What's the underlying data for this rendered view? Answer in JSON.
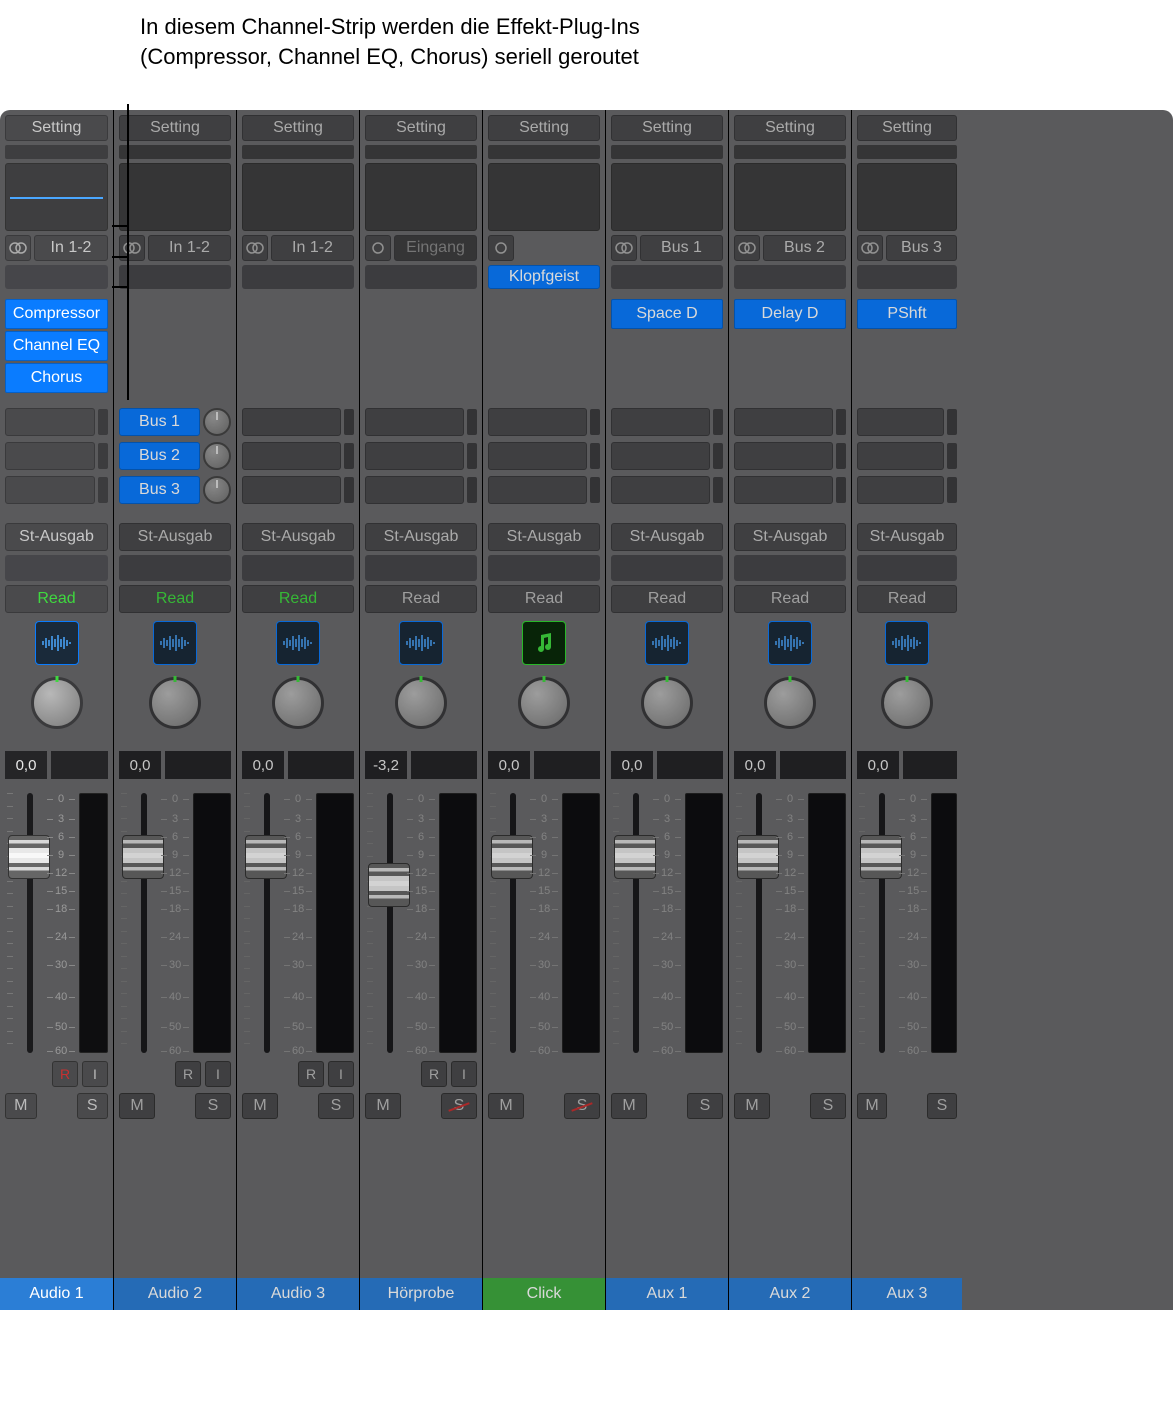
{
  "callout": "In diesem Channel-Strip werden die Effekt-Plug-Ins (Compressor, Channel EQ, Chorus) seriell geroutet",
  "labels": {
    "setting": "Setting",
    "output": "St-Ausgab",
    "read": "Read",
    "mute": "M",
    "solo": "S",
    "rec": "R",
    "input_mon": "I"
  },
  "scale": [
    "0",
    "3",
    "6",
    "9",
    "12",
    "15",
    "18",
    "24",
    "30",
    "40",
    "50",
    "60"
  ],
  "strips": [
    {
      "name": "Audio 1",
      "nameColor": "blue",
      "input": "In 1-2",
      "stereo": true,
      "inst": "",
      "plugins": [
        "Compressor",
        "Channel EQ",
        "Chorus"
      ],
      "sends": [],
      "autoGreen": true,
      "iconMusic": false,
      "gain": "0,0",
      "faderTop": 42,
      "showRI": true,
      "soloDisabled": false,
      "recHot": true,
      "eqLine": true,
      "dim": false
    },
    {
      "name": "Audio 2",
      "nameColor": "blue",
      "input": "In 1-2",
      "stereo": true,
      "inst": "",
      "plugins": [],
      "sends": [
        "Bus 1",
        "Bus 2",
        "Bus 3"
      ],
      "autoGreen": true,
      "iconMusic": false,
      "gain": "0,0",
      "faderTop": 42,
      "showRI": true,
      "soloDisabled": false,
      "recHot": false,
      "eqLine": false,
      "dim": true
    },
    {
      "name": "Audio 3",
      "nameColor": "blue",
      "input": "In 1-2",
      "stereo": true,
      "inst": "",
      "plugins": [],
      "sends": [],
      "autoGreen": true,
      "iconMusic": false,
      "gain": "0,0",
      "faderTop": 42,
      "showRI": true,
      "soloDisabled": false,
      "recHot": false,
      "eqLine": false,
      "dim": true
    },
    {
      "name": "Hörprobe",
      "nameColor": "blue",
      "input": "Eingang",
      "stereo": false,
      "inst": "",
      "plugins": [],
      "sends": [],
      "autoGreen": false,
      "iconMusic": false,
      "gain": "-3,2",
      "faderTop": 70,
      "showRI": true,
      "soloDisabled": true,
      "recHot": false,
      "eqLine": false,
      "dim": true
    },
    {
      "name": "Click",
      "nameColor": "green",
      "input": "",
      "stereo": false,
      "inst": "Klopfgeist",
      "plugins": [],
      "sends": [],
      "autoGreen": false,
      "iconMusic": true,
      "gain": "0,0",
      "faderTop": 42,
      "showRI": false,
      "soloDisabled": true,
      "recHot": false,
      "eqLine": false,
      "dim": true
    },
    {
      "name": "Aux 1",
      "nameColor": "blue",
      "input": "Bus 1",
      "stereo": true,
      "inst": "",
      "plugins": [
        "Space D"
      ],
      "sends": [],
      "autoGreen": false,
      "iconMusic": false,
      "gain": "0,0",
      "faderTop": 42,
      "showRI": false,
      "soloDisabled": false,
      "recHot": false,
      "eqLine": false,
      "dim": true
    },
    {
      "name": "Aux 2",
      "nameColor": "blue",
      "input": "Bus 2",
      "stereo": true,
      "inst": "",
      "plugins": [
        "Delay D"
      ],
      "sends": [],
      "autoGreen": false,
      "iconMusic": false,
      "gain": "0,0",
      "faderTop": 42,
      "showRI": false,
      "soloDisabled": false,
      "recHot": false,
      "eqLine": false,
      "dim": true
    },
    {
      "name": "Aux 3",
      "nameColor": "blue",
      "input": "Bus 3",
      "stereo": true,
      "inst": "",
      "plugins": [
        "PShft"
      ],
      "sends": [],
      "autoGreen": false,
      "iconMusic": false,
      "gain": "0,0",
      "faderTop": 42,
      "showRI": false,
      "soloDisabled": false,
      "recHot": false,
      "eqLine": false,
      "dim": true
    }
  ]
}
